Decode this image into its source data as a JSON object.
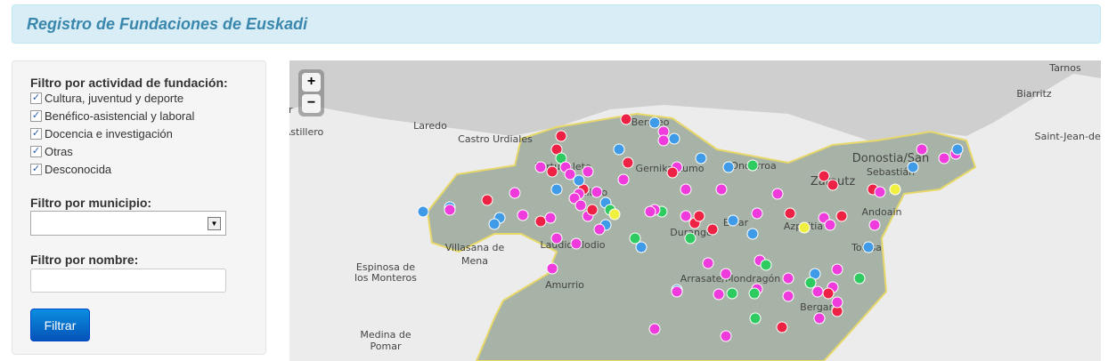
{
  "header": {
    "title": "Registro de Fundaciones de Euskadi"
  },
  "filters": {
    "activity_label": "Filtro por actividad de fundación:",
    "activities": [
      {
        "label": "Cultura, juventud y deporte",
        "checked": true
      },
      {
        "label": "Benéfico-asistencial y laboral",
        "checked": true
      },
      {
        "label": "Docencia e investigación",
        "checked": true
      },
      {
        "label": "Otras",
        "checked": true
      },
      {
        "label": "Desconocida",
        "checked": true
      }
    ],
    "municipio_label": "Filtro por municipio:",
    "municipio_value": "",
    "nombre_label": "Filtro por nombre:",
    "nombre_value": "",
    "submit_label": "Filtrar"
  },
  "map": {
    "zoom_in": "+",
    "zoom_out": "−",
    "colors": {
      "sea": "#cfcfcf",
      "land": "#ececec",
      "region": "#a7b3a6",
      "border": "#e8d86a",
      "markers": [
        "#f03bdc",
        "#ee2244",
        "#3f9ae8",
        "#2ecc60",
        "#f0f040"
      ]
    },
    "places": [
      "Tarnos",
      "Biarritz",
      "Saint-Jean-de-Luz",
      "Laredo",
      "Castro Urdiales",
      "Astillero",
      "Santander",
      "Bermeo",
      "Gernika-Lumo",
      "Ondarroa",
      "Zarautz",
      "Donostia/San",
      "Sebastián",
      "Andoain",
      "Tolosa",
      "Azpeitia",
      "Eibar",
      "Durango",
      "Bilbao",
      "Portugalete",
      "Laudio/Llodio",
      "Amurrio",
      "Arrasate/Mondragón",
      "Bergara",
      "Villasana de",
      "Mena",
      "Espinosa de",
      "los Monteros",
      "Medina de",
      "Pomar"
    ]
  }
}
